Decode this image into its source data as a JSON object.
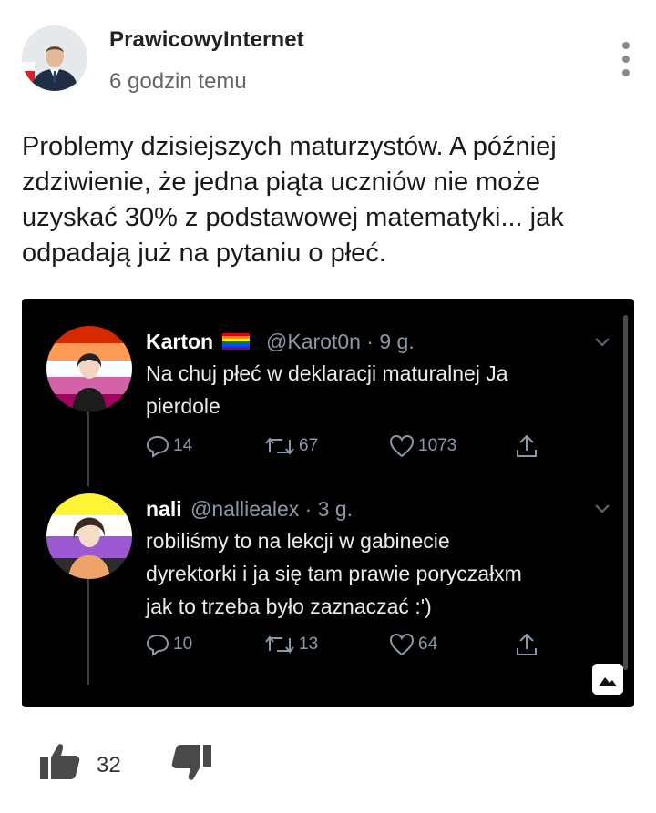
{
  "post": {
    "author": "PrawicowyInternet",
    "time": "6 godzin temu",
    "text": "Problemy dzisiejszych maturzystów. A później zdziwienie, że jedna piąta uczniów nie może uzyskać 30% z podstawowej matematyki... jak odpadają już na pytaniu o płeć."
  },
  "tweets": [
    {
      "name": "Karton",
      "handle": "@Karot0n · 9 g.",
      "text_line1": "Na chuj płeć w deklaracji maturalnej Ja",
      "text_line2": "pierdole",
      "replies": "14",
      "retweets": "67",
      "likes": "1073"
    },
    {
      "name": "nali",
      "handle": "@nalliealex · 3 g.",
      "text_line1": "robiliśmy to na lekcji w gabinecie",
      "text_line2": "dyrektorki i ja się tam prawie poryczałxm",
      "text_line3": "jak to trzeba było zaznaczać :')",
      "replies": "10",
      "retweets": "13",
      "likes": "64"
    }
  ],
  "reactions": {
    "likes": "32"
  },
  "icons": [
    "more-vert-icon",
    "flag-icon",
    "reply-icon",
    "retweet-icon",
    "heart-icon",
    "share-icon",
    "chevron-down-icon",
    "image-icon",
    "thumb-up-icon",
    "thumb-down-icon"
  ]
}
